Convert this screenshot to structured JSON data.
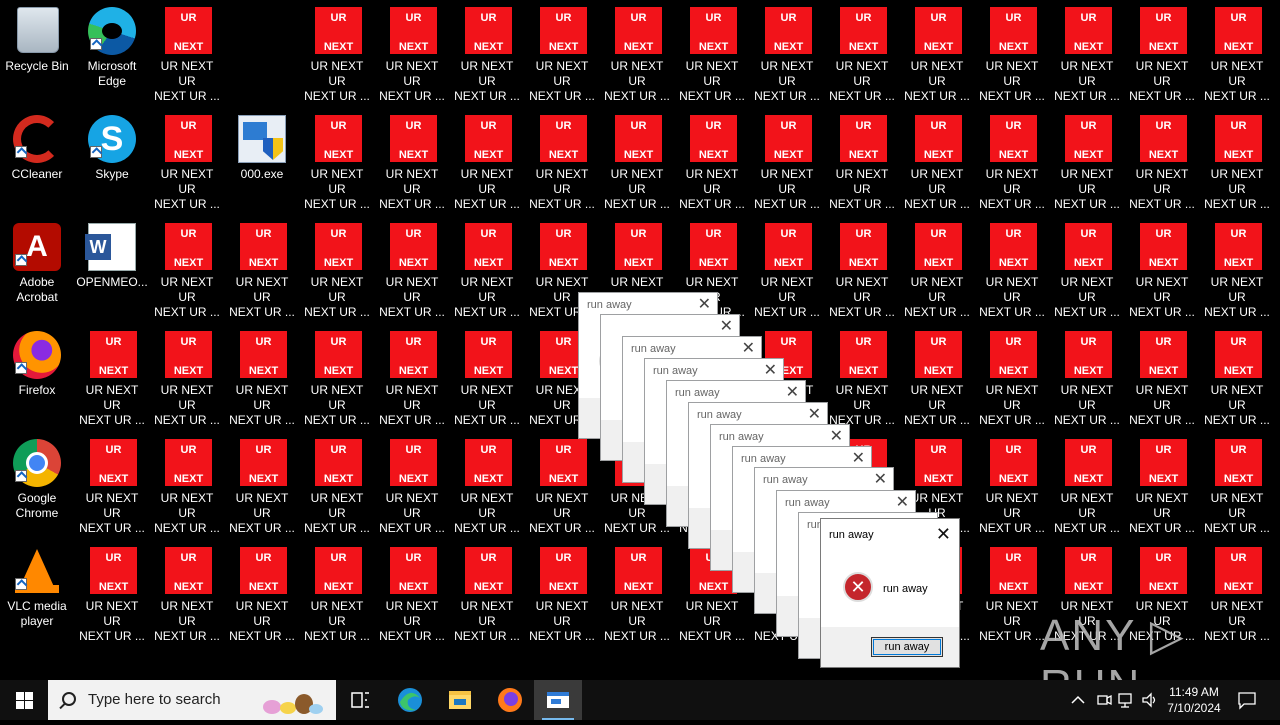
{
  "desktop": {
    "icons": {
      "recycle_bin": "Recycle Bin",
      "edge": "Microsoft Edge",
      "ccleaner": "CCleaner",
      "skype": "Skype",
      "exe": "000.exe",
      "acrobat": "Adobe Acrobat",
      "openmeo": "OPENMEO...",
      "firefox": "Firefox",
      "chrome": "Google Chrome",
      "vlc": "VLC media player"
    },
    "ur_next": {
      "tile_top": "UR",
      "tile_bottom": "NEXT",
      "label_line1": "UR NEXT UR",
      "label_line2": "NEXT UR ..."
    },
    "skype_glyph": "S",
    "acrobat_glyph": "A"
  },
  "dialogs": {
    "title": "run away",
    "message": "run away",
    "button": "run away",
    "close_glyph": "✕",
    "error_glyph": "✕",
    "accent_color": "#c4262c"
  },
  "watermark": "ANY ▷ RUN",
  "taskbar": {
    "search_placeholder": "Type here to search",
    "time": "11:49 AM",
    "date": "7/10/2024"
  },
  "colors": {
    "tile_red": "#f2131a",
    "desktop_bg": "#000000",
    "taskbar_bg": "#101010"
  }
}
